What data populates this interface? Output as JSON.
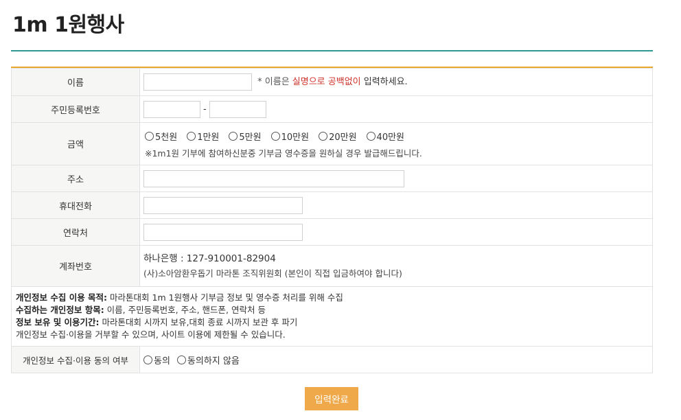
{
  "page": {
    "title": "1m 1원행사"
  },
  "form": {
    "name": {
      "label": "이름",
      "value": "",
      "hint_prefix": "* 이름은 ",
      "hint_red": "실명으로 공백없이",
      "hint_suffix": " 입력하세요."
    },
    "rrn": {
      "label": "주민등록번호",
      "first": "",
      "separator": "-",
      "second": ""
    },
    "amount": {
      "label": "금액",
      "options": [
        "5천원",
        "1만원",
        "5만원",
        "10만원",
        "20만원",
        "40만원"
      ],
      "note": "※1m1원 기부에 참여하신분중 기부금 영수증을 원하실 경우 발급해드립니다."
    },
    "address": {
      "label": "주소",
      "value": ""
    },
    "mobile": {
      "label": "휴대전화",
      "value": ""
    },
    "contact": {
      "label": "연락처",
      "value": ""
    },
    "account": {
      "label": "계좌번호",
      "line1": "하나은행 : 127-910001-82904",
      "line2": "(사)소아암환우돕기 마라톤 조직위원회 (본인이 직접 입금하여야 합니다)"
    },
    "privacy": {
      "purpose_label": "개인정보 수집 이용 목적:",
      "purpose_text": " 마라톤대회 1m 1원행사 기부금 정보 및 영수증 처리를 위해 수집",
      "items_label": "수집하는 개인정보 항목:",
      "items_text": " 이름, 주민등록번호, 주소, 핸드폰, 연락처 등",
      "period_label": "정보 보유 및 이용기간:",
      "period_text": " 마라톤대회 시까지 보유,대회 종료 시까지 보관 후 파기",
      "refuse_text": "개인정보 수집·이용을 거부할 수 있으며, 사이트 이용에 제한될 수 있습니다."
    },
    "consent": {
      "label": "개인정보 수집·이용 동의 여부",
      "agree": "동의",
      "disagree": "동의하지 않음"
    }
  },
  "submit": {
    "label": "입력완료"
  }
}
